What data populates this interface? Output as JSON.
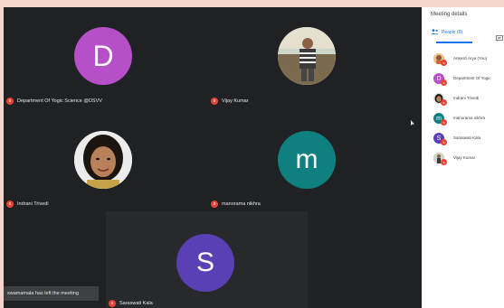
{
  "participants": [
    {
      "name": "Department Of Yogic Science @DSVV",
      "initial": "D",
      "color": "#b650c8",
      "has_photo": false
    },
    {
      "name": "Vijay Kumar",
      "initial": "",
      "color": "",
      "has_photo": true
    },
    {
      "name": "Indrani Trivedi",
      "initial": "",
      "color": "",
      "has_photo": true
    },
    {
      "name": "manorama nikhra",
      "initial": "m",
      "color": "#0f8080",
      "has_photo": false
    },
    {
      "name": "Saraswati Kala",
      "initial": "S",
      "color": "#5b3fb4",
      "has_photo": false
    }
  ],
  "mute_icon_glyph": "s",
  "toast": {
    "text": "swamamala has left the meeting"
  },
  "panel": {
    "title": "Meeting details",
    "tab_people": "People (6)",
    "tab_chat_icon": "chat-icon",
    "people": [
      {
        "name": "Ankesh Arya (You)",
        "initial": "",
        "color": "#f6b26b",
        "has_photo": true
      },
      {
        "name": "Department Of Yogic",
        "initial": "D",
        "color": "#b650c8",
        "has_photo": false
      },
      {
        "name": "Indrani Trivedi",
        "initial": "",
        "color": "#7a5230",
        "has_photo": true
      },
      {
        "name": "manorama nikhra",
        "initial": "m",
        "color": "#0f8080",
        "has_photo": false
      },
      {
        "name": "Saraswati Kala",
        "initial": "S",
        "color": "#5b3fb4",
        "has_photo": false
      },
      {
        "name": "Vijay Kumar",
        "initial": "",
        "color": "#8a7a5a",
        "has_photo": true
      }
    ]
  }
}
